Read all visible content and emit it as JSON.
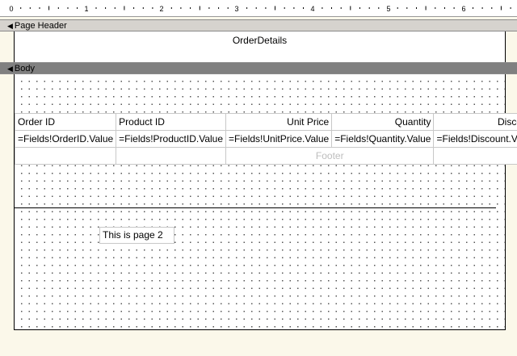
{
  "ruler": {
    "labels": [
      "0",
      "1",
      "2",
      "3",
      "4",
      "5",
      "6"
    ]
  },
  "bands": {
    "page_header": "Page Header",
    "body": "Body"
  },
  "header": {
    "title": "OrderDetails"
  },
  "table": {
    "headers": [
      "Order ID",
      "Product ID",
      "Unit Price",
      "Quantity",
      "Discount"
    ],
    "detail": [
      "=Fields!OrderID.Value",
      "=Fields!ProductID.Value",
      "=Fields!UnitPrice.Value",
      "=Fields!Quantity.Value",
      "=Fields!Discount.Value"
    ],
    "footer": "Footer"
  },
  "page_textbox": "This is page 2",
  "colors": {
    "designer_bg": "#fbf8ea",
    "header_bar": "#d6d3ce",
    "body_bar": "#808080"
  }
}
